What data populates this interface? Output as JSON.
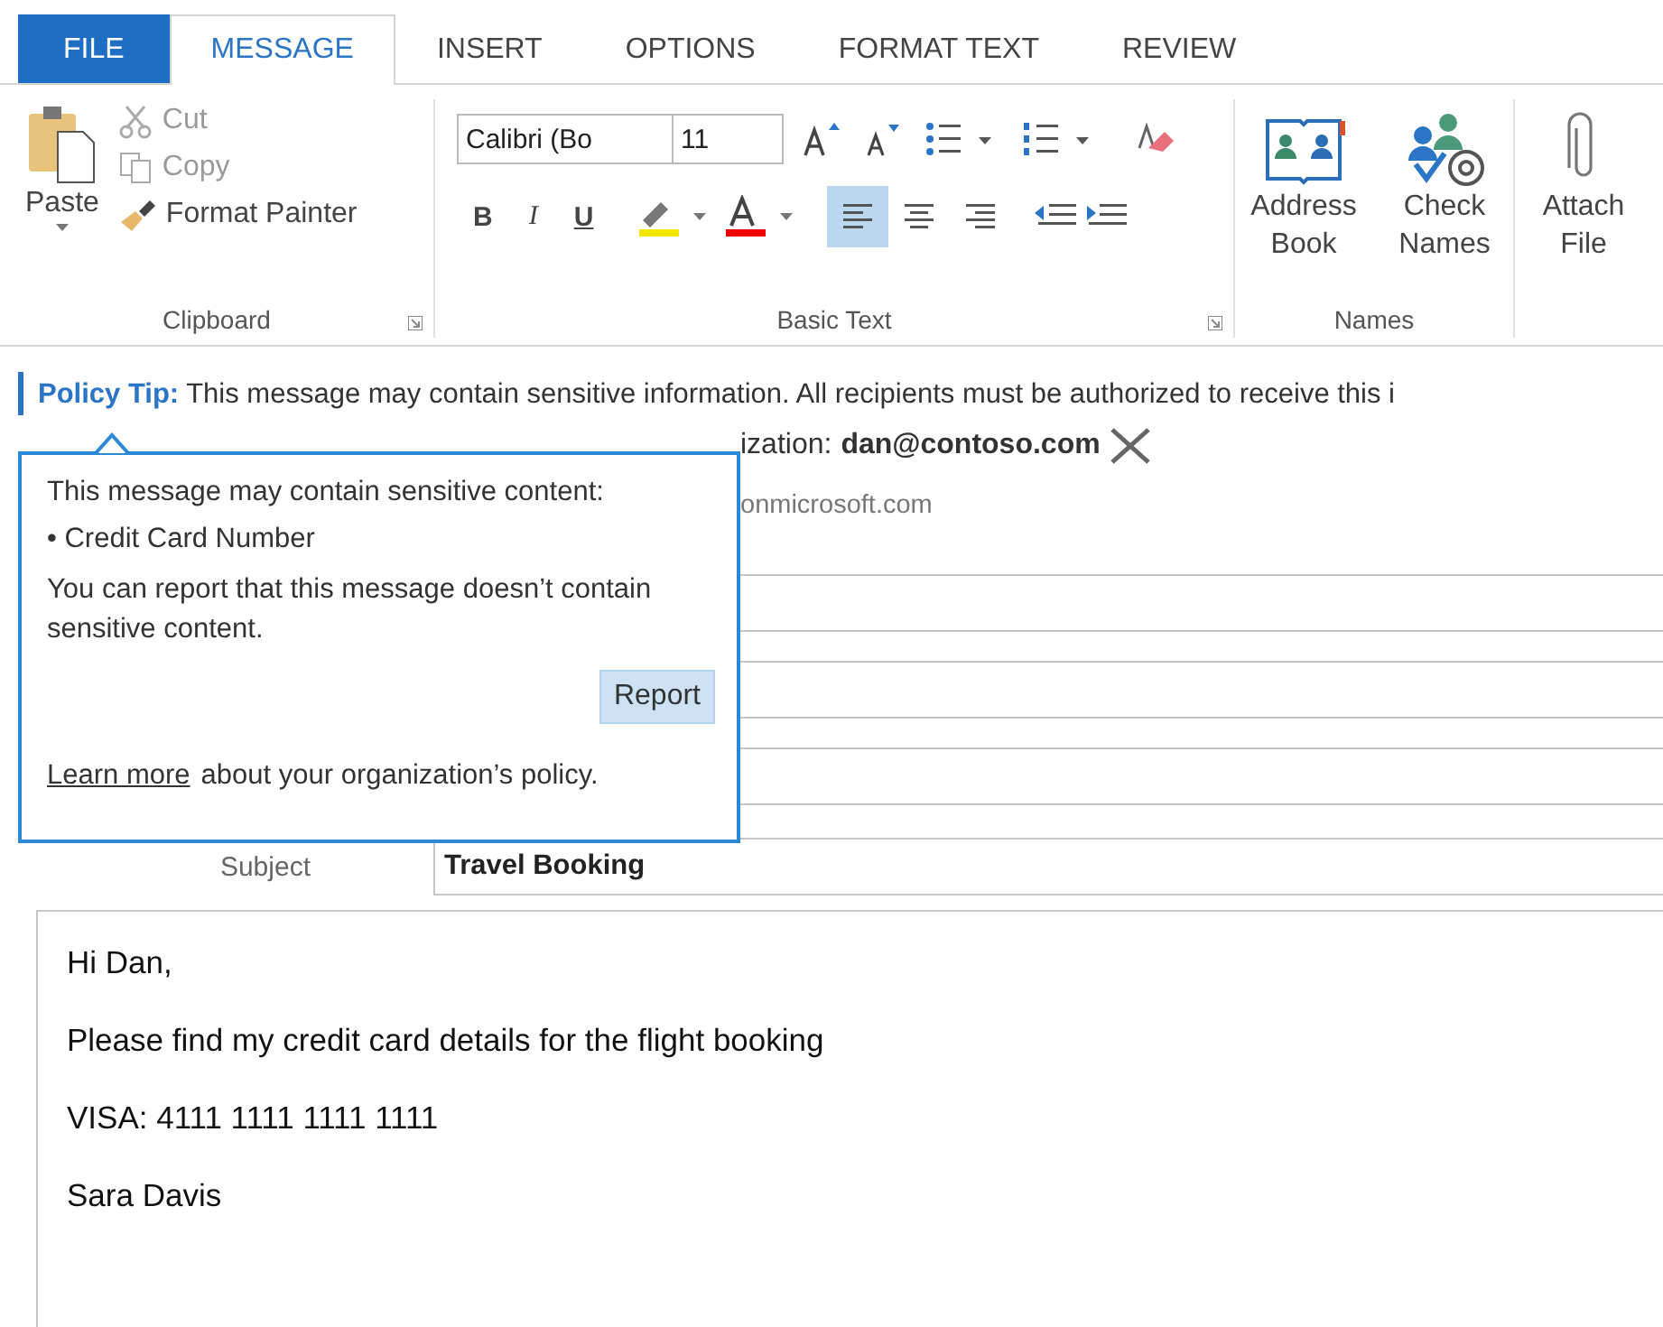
{
  "tabs": [
    {
      "label": "FILE",
      "kind": "file",
      "selected": false
    },
    {
      "label": "MESSAGE",
      "kind": "tab",
      "selected": true
    },
    {
      "label": "INSERT",
      "kind": "tab",
      "selected": false
    },
    {
      "label": "OPTIONS",
      "kind": "tab",
      "selected": false
    },
    {
      "label": "FORMAT TEXT",
      "kind": "tab",
      "selected": false
    },
    {
      "label": "REVIEW",
      "kind": "tab",
      "selected": false
    }
  ],
  "clipboard": {
    "paste": "Paste",
    "cut": "Cut",
    "copy": "Copy",
    "format_painter": "Format Painter",
    "label": "Clipboard"
  },
  "basic_text": {
    "font": "Calibri (Bo",
    "size": "11",
    "bold": "B",
    "italic": "I",
    "underline": "U",
    "label": "Basic Text",
    "alignments": [
      {
        "kind": "left",
        "selected": true
      },
      {
        "kind": "center",
        "selected": false
      },
      {
        "kind": "right",
        "selected": false
      }
    ]
  },
  "names": {
    "buttons": [
      {
        "kind": "address",
        "label": "Address Book"
      },
      {
        "kind": "check",
        "label": "Check Names"
      }
    ],
    "label": "Names"
  },
  "attach": {
    "label": "Attach File"
  },
  "policy_tip": {
    "label": "Policy Tip:",
    "text": "This message may contain sensitive information. All recipients must be authorized to receive this i"
  },
  "external_notice": {
    "text": "ization:",
    "email": "dan@contoso.com"
  },
  "from": "onmicrosoft.com",
  "popup": {
    "heading": "This message may contain sensitive content:",
    "items": [
      "• Credit Card Number"
    ],
    "note": "You can report that this message doesn’t contain sensitive content.",
    "report": "Report",
    "learn_more": "Learn more",
    "policy": "about your organization’s policy."
  },
  "subject": {
    "label": "Subject",
    "value": "Travel Booking"
  },
  "body": [
    "Hi Dan,",
    "Please find my credit card details for the flight booking",
    "VISA: 4111 1111 1111 1111",
    "Sara Davis"
  ]
}
